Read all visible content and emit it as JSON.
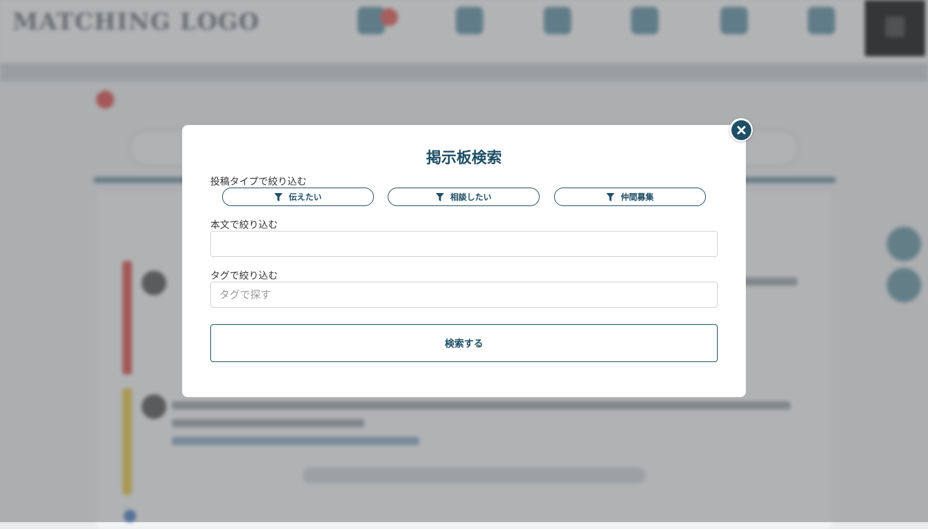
{
  "modal": {
    "title": "掲示板検索",
    "type_filter_label": "投稿タイプで絞り込む",
    "type_buttons": [
      {
        "label": "伝えたい"
      },
      {
        "label": "相談したい"
      },
      {
        "label": "仲間募集"
      }
    ],
    "body_filter_label": "本文で絞り込む",
    "body_input": {
      "value": "",
      "placeholder": ""
    },
    "tag_filter_label": "タグで絞り込む",
    "tag_input": {
      "value": "",
      "placeholder": "タグで探す"
    },
    "search_button_label": "検索する"
  },
  "icons": {
    "close": "close-circle-icon",
    "filter": "filter-funnel-icon"
  },
  "colors": {
    "accent": "#1f4f66",
    "overlay": "#626466",
    "nav_badge": "#e05a5a"
  }
}
